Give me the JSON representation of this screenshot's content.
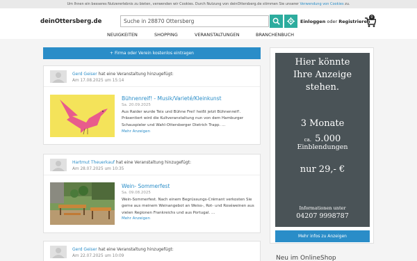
{
  "cookie_bar": {
    "text": "Um Ihnen ein besseres Nutzererlebnis zu bieten, verwenden wir Cookies. Durch Nutzung von deinOttersberg.de stimmen Sie unserer",
    "link_text": "Verwendung von Cookies",
    "suffix": " zu."
  },
  "header": {
    "logo": "deinOttersberg.de",
    "search_value": "Suche in 28870 Ottersberg",
    "login_label": "Einloggen",
    "or_label": " oder ",
    "register_label": "Registrieren",
    "cart_count": "0"
  },
  "nav": {
    "items": [
      "NEUIGKEITEN",
      "SHOPPING",
      "VERANSTALTUNGEN",
      "BRANCHENBUCH"
    ]
  },
  "add_button": "+ Firma oder Verein kostenlos eintragen",
  "feed": [
    {
      "user": "Gerd Geiser",
      "action": " hat eine Veranstaltung hinzugefügt:",
      "posted": "Am 17.08.2025 um 15:14",
      "title": "Bühnenreif! - Musik/Varieté/Kleinkunst",
      "date": "Sa. 20.09.2025",
      "description": "Aus Raider wurde Teix und Bühne Frei! heißt jetzt Bühnenreif!. Präsentiert wird die Kultveranstaltung nun von dem Hamburger Schauspieler und Wahl-Ottersberger Dietrich Trapp. ...",
      "more": "Mehr Anzeigen"
    },
    {
      "user": "Hartmut Theuerkauf",
      "action": " hat eine Veranstaltung hinzugefügt:",
      "posted": "Am 28.07.2025 um 10:35",
      "title": "Wein- Sommerfest",
      "date": "Sa. 09.08.2025",
      "description": "Wein-Sommerfest. Nach einem Begrüssungs-Crémant verkosten Sie gerne aus meinem Weinangebot an Weiss-, Rot- und Roséweinen aus vielen Regionen Frankreichs und aus Portugal. ...",
      "more": "Mehr Anzeigen"
    },
    {
      "user": "Gerd Geiser",
      "action": " hat eine Veranstaltung hinzugefügt:",
      "posted": "Am 22.07.2025 um 10:09"
    }
  ],
  "sidebar": {
    "ad": {
      "line1": "Hier könnte",
      "line2": "Ihre Anzeige",
      "line3": "stehen.",
      "line4": "3 Monate",
      "line5_prefix": "ca.",
      "line5_value": "5.000",
      "line6": "Einblendungen",
      "line7": "nur 29,- €",
      "line8": "Informationen unter",
      "line9": "04207 9998787"
    },
    "ad_button": "Mehr infos zu Anzeigen",
    "shop_heading": "Neu im OnlineShop"
  },
  "colors": {
    "accent_blue": "#2a8dc8",
    "teal": "#2dac9e",
    "ad_bg": "#4a5357"
  }
}
